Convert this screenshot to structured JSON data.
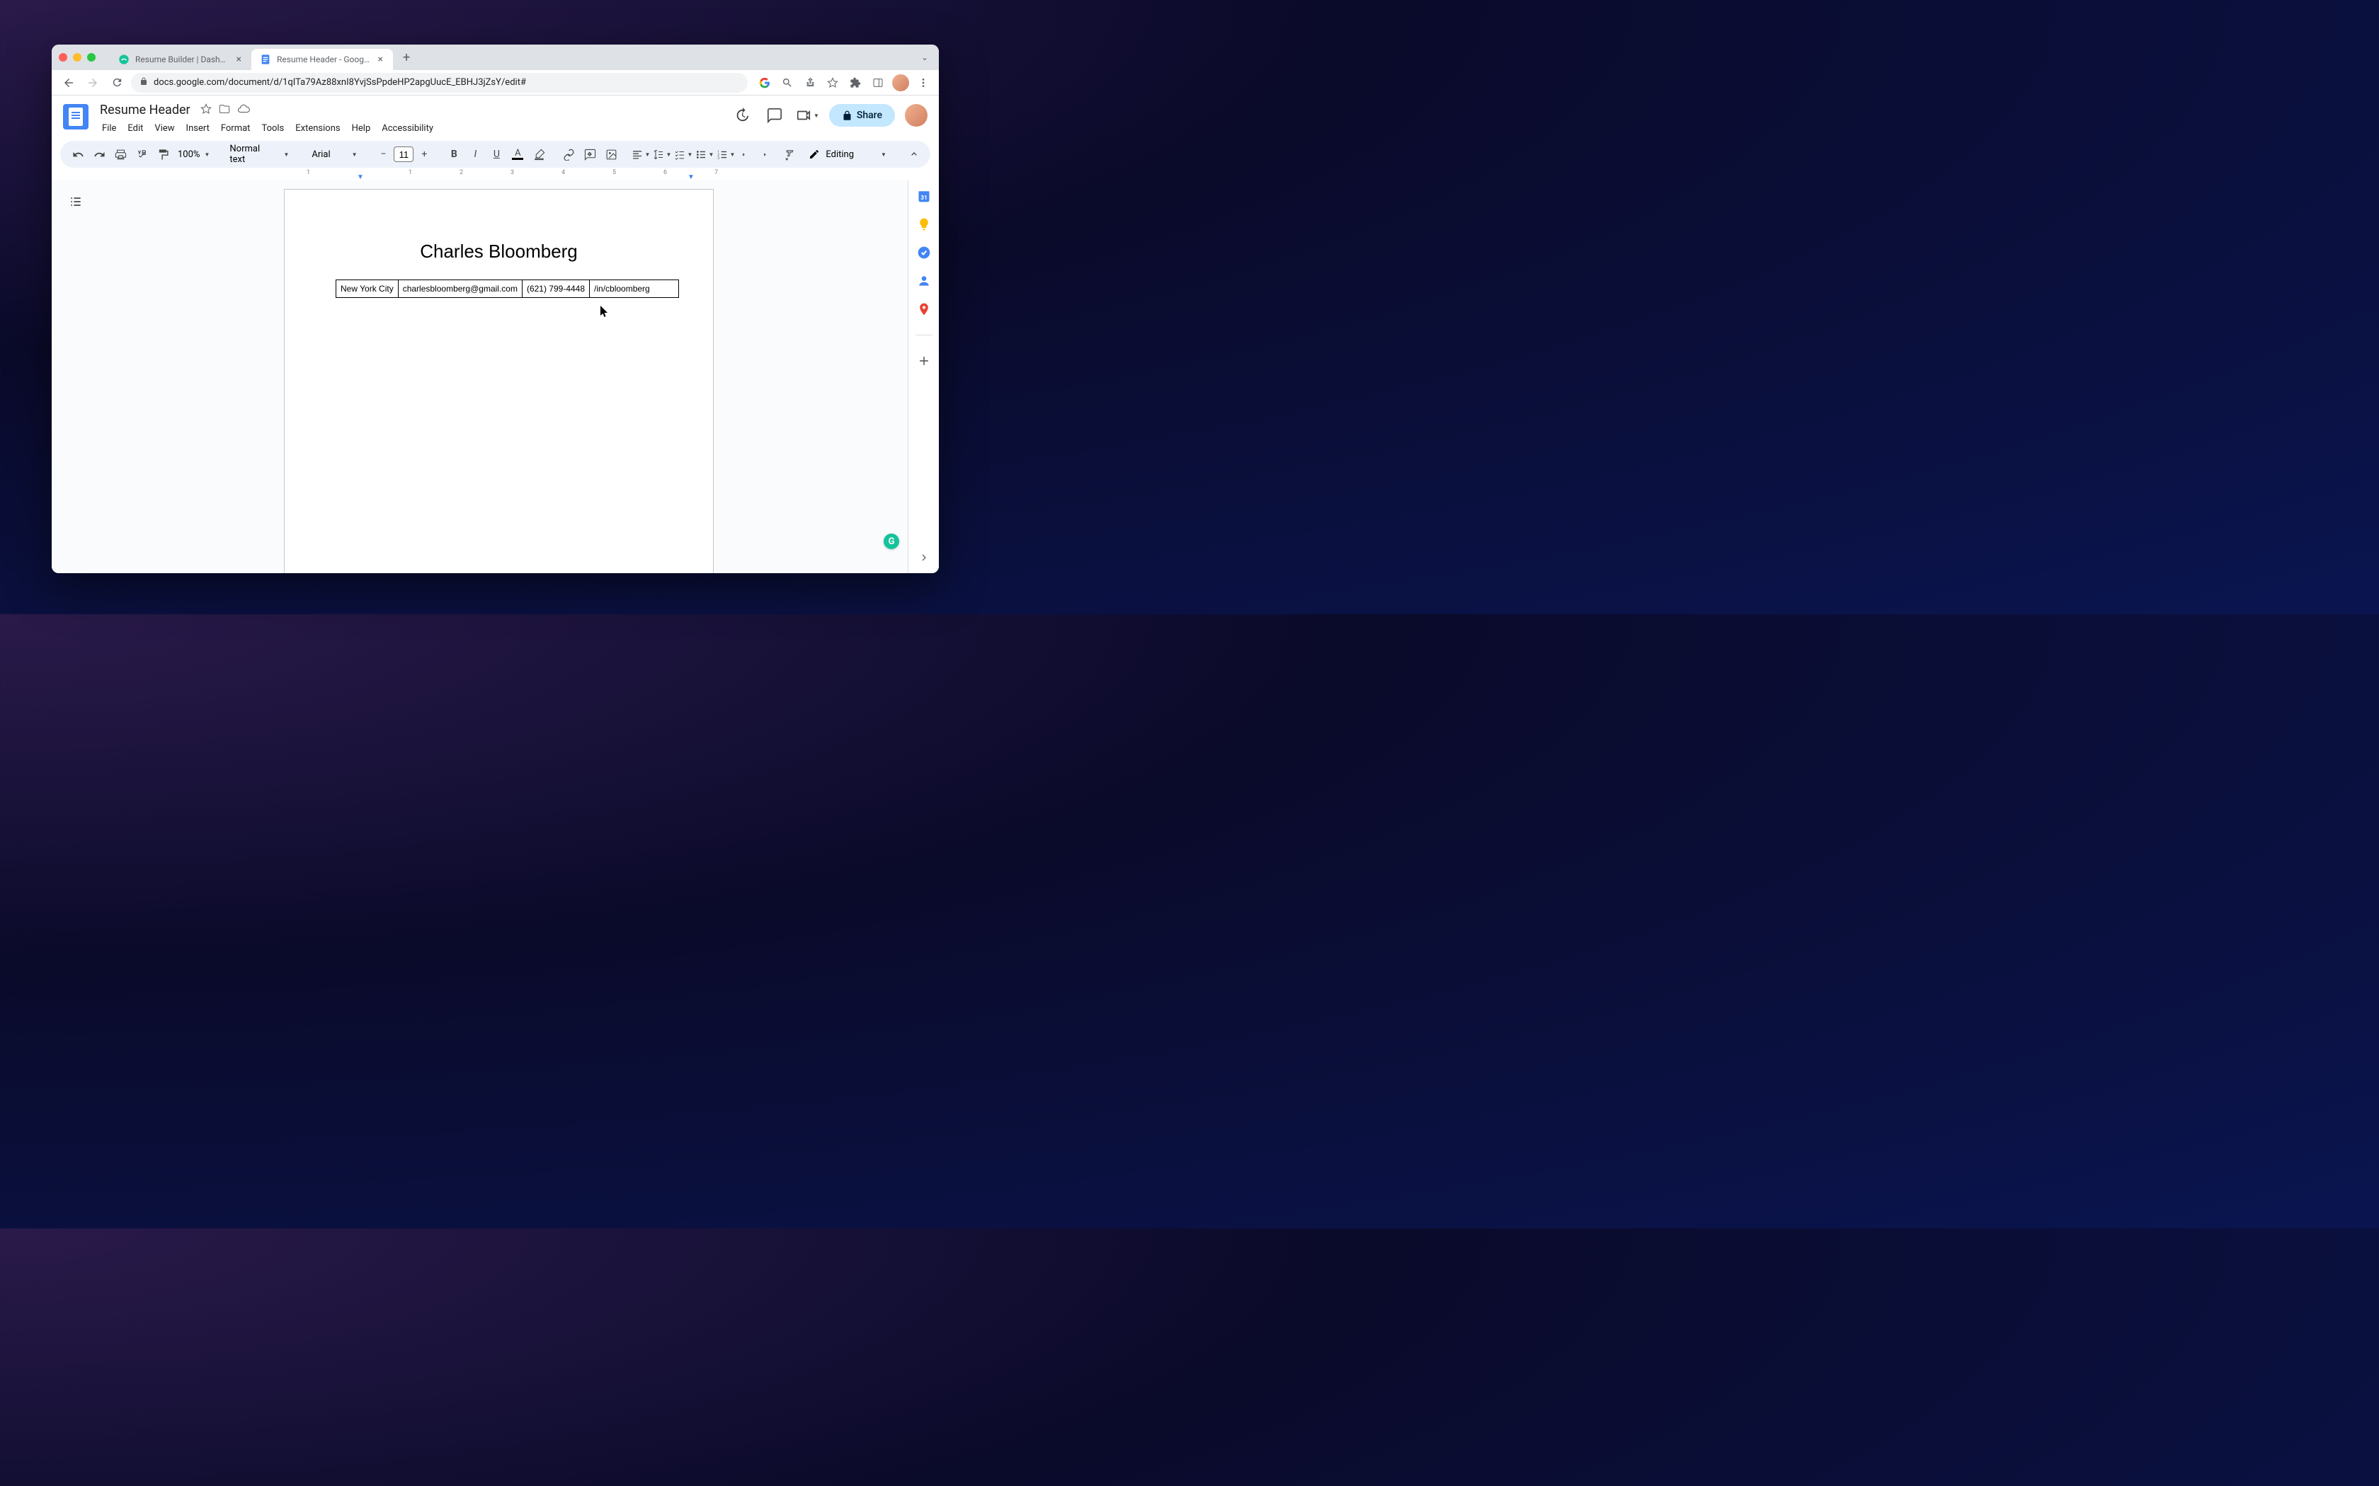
{
  "browser": {
    "tabs": [
      {
        "title": "Resume Builder | Dashboard",
        "active": false
      },
      {
        "title": "Resume Header - Google Docs",
        "active": true
      }
    ],
    "url": "docs.google.com/document/d/1qITa79Az88xnI8YvjSsPpdeHP2apgUucE_EBHJ3jZsY/edit#"
  },
  "docs": {
    "title": "Resume Header",
    "menus": [
      "File",
      "Edit",
      "View",
      "Insert",
      "Format",
      "Tools",
      "Extensions",
      "Help",
      "Accessibility"
    ],
    "share_label": "Share"
  },
  "toolbar": {
    "zoom": "100%",
    "style": "Normal text",
    "font": "Arial",
    "font_size": "11",
    "mode": "Editing"
  },
  "ruler": {
    "h_labels": [
      "1",
      "1",
      "2",
      "3",
      "4",
      "5",
      "6",
      "7"
    ]
  },
  "document": {
    "name": "Charles Bloomberg",
    "contact": {
      "city": "New York City",
      "email": "charlesbloomberg@gmail.com",
      "phone": "(621) 799-4448",
      "linkedin": "/in/cbloomberg"
    }
  }
}
